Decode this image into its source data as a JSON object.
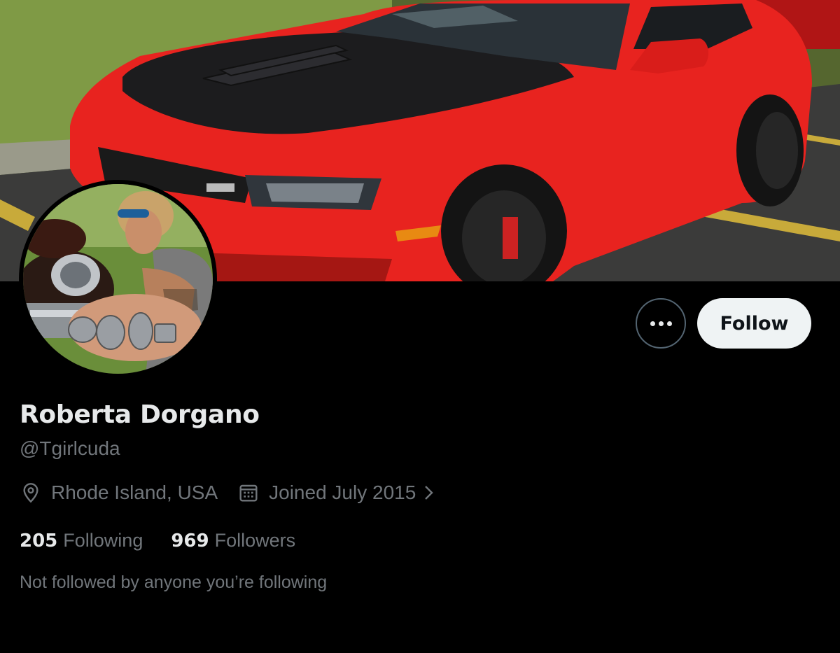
{
  "profile": {
    "display_name": "Roberta Dorgano",
    "handle": "@Tgirlcuda",
    "location": "Rhode Island, USA",
    "joined": "Joined July 2015",
    "following_count": "205",
    "following_label": "Following",
    "followers_count": "969",
    "followers_label": "Followers",
    "followed_by_text": "Not followed by anyone you’re following"
  },
  "actions": {
    "follow_label": "Follow",
    "more_icon": "ellipsis-icon"
  },
  "icons": {
    "location": "location-pin-icon",
    "joined": "calendar-icon",
    "chevron": "chevron-right-icon"
  },
  "colors": {
    "background": "#000000",
    "primary_text": "#e7e9ea",
    "secondary_text": "#71767b",
    "follow_button_bg": "#eff3f4",
    "follow_button_text": "#0f1419",
    "banner_car": "#e8231f"
  }
}
